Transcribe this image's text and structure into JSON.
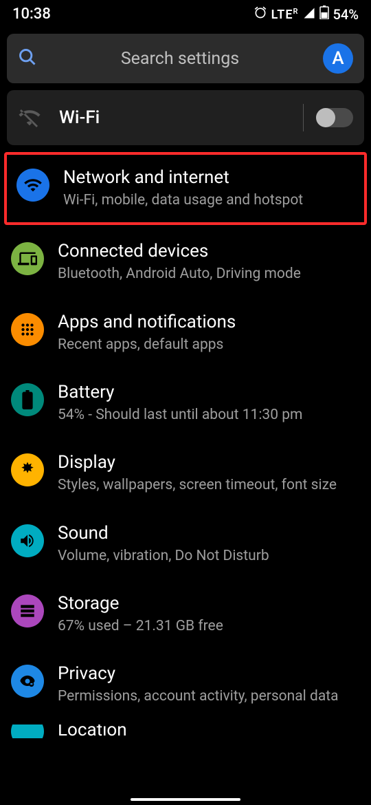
{
  "status": {
    "time": "10:38",
    "lte": "LTE",
    "battery_text": "54%"
  },
  "search": {
    "placeholder": "Search settings",
    "avatar_letter": "A"
  },
  "wifi_card": {
    "label": "Wi-Fi"
  },
  "items": [
    {
      "title": "Network and internet",
      "subtitle": "Wi-Fi, mobile, data usage and hotspot",
      "icon": "wifi-icon",
      "color": "#1a73e8"
    },
    {
      "title": "Connected devices",
      "subtitle": "Bluetooth, Android Auto, Driving mode",
      "icon": "devices-icon",
      "color": "#7cb342"
    },
    {
      "title": "Apps and notifications",
      "subtitle": "Recent apps, default apps",
      "icon": "apps-icon",
      "color": "#fb8c00"
    },
    {
      "title": "Battery",
      "subtitle": "54% - Should last until about 11:30 pm",
      "icon": "battery-icon",
      "color": "#00897b"
    },
    {
      "title": "Display",
      "subtitle": "Styles, wallpapers, screen timeout, font size",
      "icon": "display-icon",
      "color": "#ffb300"
    },
    {
      "title": "Sound",
      "subtitle": "Volume, vibration, Do Not Disturb",
      "icon": "sound-icon",
      "color": "#00acc1"
    },
    {
      "title": "Storage",
      "subtitle": "67% used – 21.31 GB free",
      "icon": "storage-icon",
      "color": "#ab47bc"
    },
    {
      "title": "Privacy",
      "subtitle": "Permissions, account activity, personal data",
      "icon": "privacy-icon",
      "color": "#1e88e5"
    },
    {
      "title": "Location",
      "subtitle": "",
      "icon": "location-icon",
      "color": "#00acc1"
    }
  ]
}
